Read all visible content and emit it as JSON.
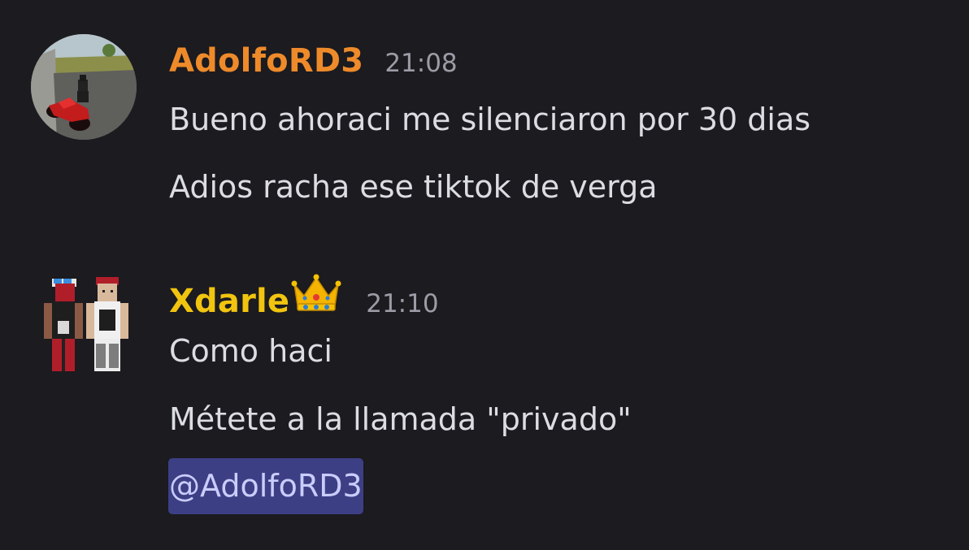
{
  "messages": [
    {
      "author": "AdolfoRD3",
      "author_color": "#ee8a2a",
      "time": "21:08",
      "avatar_icon": "motorcycle-avatar",
      "lines": [
        "Bueno ahoraci me silenciaron por 30 dias",
        "Adios racha ese tiktok de verga"
      ]
    },
    {
      "author": "Xdarle",
      "author_color": "#f1c40f",
      "author_badge_icon": "crown-icon",
      "time": "21:10",
      "avatar_icon": "two-roblox-characters-avatar",
      "lines": [
        "Como haci",
        "Métete a la llamada \"privado\""
      ],
      "mention": "@AdolfoRD3",
      "mention_bg": "#3d3f85"
    }
  ]
}
